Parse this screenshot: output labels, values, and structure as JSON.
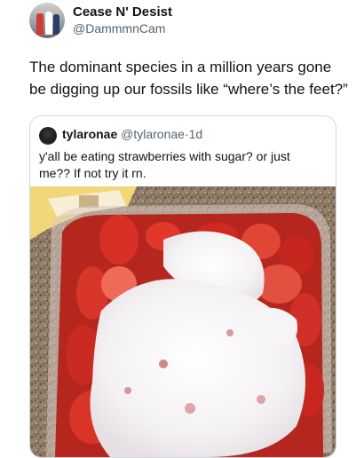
{
  "tweet": {
    "author": {
      "name": "Cease N' Desist",
      "handle": "@DammmnCam"
    },
    "text": "The dominant species in a million years gone be digging up our fossils like “where’s the feet?”"
  },
  "quoted_tweet": {
    "author": {
      "name": "tylaronae",
      "handle": "@tylaronae",
      "separator": "·",
      "age": "1d"
    },
    "text": "y'all be eating strawberries with sugar? or just me?? If not try it rn.",
    "image": {
      "subject": "strawberries-with-sugar-in-container"
    }
  },
  "colors": {
    "text_primary": "#0f1419",
    "text_secondary": "#536471",
    "card_border": "#cfd9de"
  }
}
